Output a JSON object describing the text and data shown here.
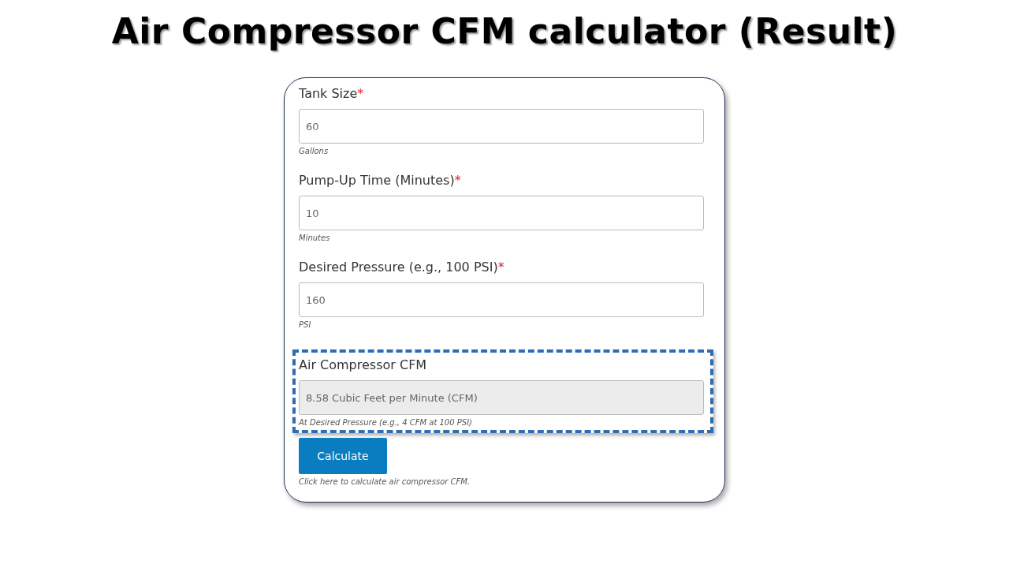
{
  "heading": "Air Compressor CFM calculator (Result)",
  "fields": [
    {
      "label": "Tank Size",
      "required_mark": "*",
      "value": "60",
      "hint": "Gallons",
      "readonly": false,
      "highlighted": false
    },
    {
      "label": "Pump-Up Time (Minutes)",
      "required_mark": "*",
      "value": "10",
      "hint": "Minutes",
      "readonly": false,
      "highlighted": false
    },
    {
      "label": "Desired Pressure (e.g., 100 PSI)",
      "required_mark": "*",
      "value": "160",
      "hint": "PSI",
      "readonly": false,
      "highlighted": false
    },
    {
      "label": "Air Compressor CFM",
      "value": "8.58 Cubic Feet per Minute (CFM)",
      "hint": "At Desired Pressure (e.g., 4 CFM at 100 PSI)",
      "readonly": true,
      "highlighted": true
    }
  ],
  "button": {
    "label": "Calculate",
    "hint": "Click here to calculate air compressor CFM."
  }
}
